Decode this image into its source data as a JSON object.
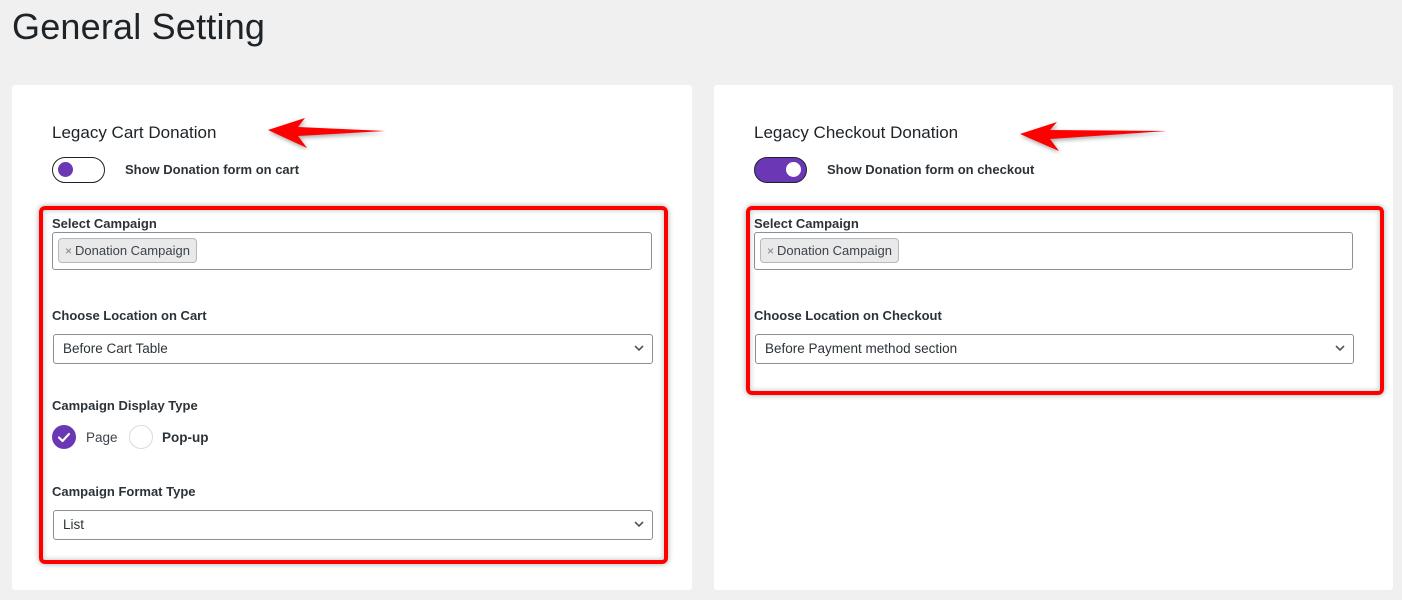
{
  "page": {
    "title": "General Setting"
  },
  "cart_card": {
    "title": "Legacy Cart Donation",
    "toggle": {
      "label": "Show Donation form on cart",
      "enabled": false
    },
    "select_campaign": {
      "label": "Select Campaign",
      "selected_chips": [
        {
          "remove_symbol": "×",
          "label": "Donation Campaign"
        }
      ]
    },
    "location": {
      "label": "Choose Location on Cart",
      "value": "Before Cart Table",
      "icon": "chevron-down-icon"
    },
    "display_type": {
      "label": "Campaign Display Type",
      "options": [
        {
          "label": "Page",
          "checked": true
        },
        {
          "label": "Pop-up",
          "checked": false
        }
      ]
    },
    "format_type": {
      "label": "Campaign Format Type",
      "value": "List",
      "icon": "chevron-down-icon"
    }
  },
  "checkout_card": {
    "title": "Legacy Checkout Donation",
    "toggle": {
      "label": "Show Donation form on checkout",
      "enabled": true
    },
    "select_campaign": {
      "label": "Select Campaign",
      "selected_chips": [
        {
          "remove_symbol": "×",
          "label": "Donation Campaign"
        }
      ]
    },
    "location": {
      "label": "Choose Location on Checkout",
      "value": "Before Payment method section",
      "icon": "chevron-down-icon"
    }
  },
  "annotations": {
    "highlight_color": "#ff0000",
    "arrow_color": "#ff0000"
  },
  "colors": {
    "accent": "#6b37b5",
    "background": "#f0f0f1",
    "card": "#ffffff"
  }
}
